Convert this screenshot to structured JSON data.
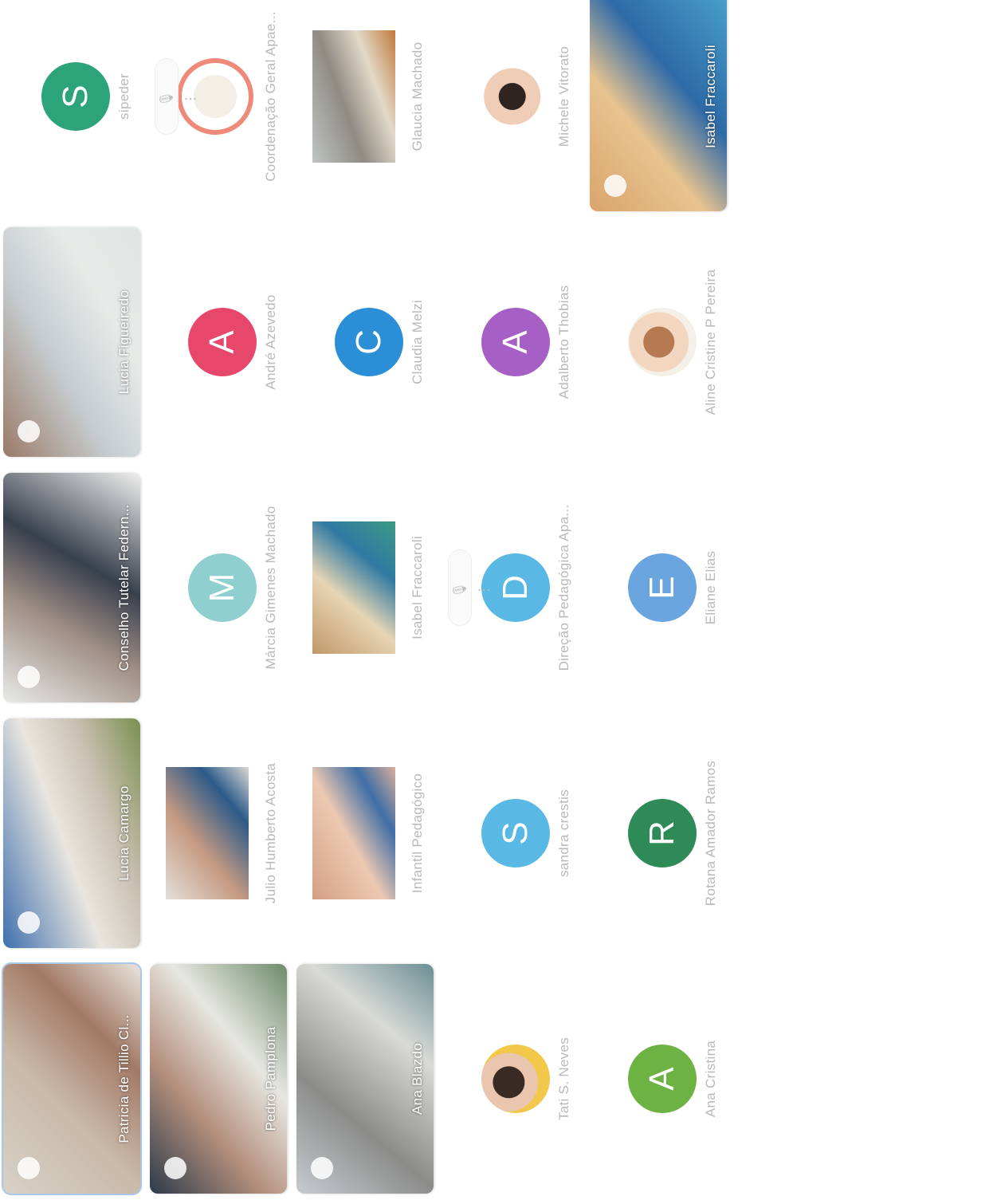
{
  "window": {
    "title": ""
  },
  "colors": {
    "green": "#2da37a",
    "pink": "#e8476c",
    "blue": "#2a8fd6",
    "purple": "#a65fc4",
    "teal": "#8fcfcf",
    "lightblue": "#5ab8e4",
    "bluegray": "#6aa5e0",
    "darkgreen": "#2e8b57",
    "lightgreen": "#6cb343",
    "ring_pink": "#ef8a7b"
  },
  "participants": [
    {
      "name": "Patricia de Tillio Cl...",
      "kind": "video",
      "active": true,
      "icon": "person-video"
    },
    {
      "name": "Lucia Camargo",
      "kind": "video",
      "icon": "person-video"
    },
    {
      "name": "Conselho Tutelar Federn...",
      "kind": "video",
      "icon": "person-video"
    },
    {
      "name": "Lucia Figueiredo",
      "kind": "video",
      "icon": "person-video"
    },
    {
      "name": "sipeder",
      "kind": "avatar",
      "letter": "S",
      "color": "green"
    },
    {
      "name": "Pedro Pamplona",
      "kind": "video",
      "icon": "person-video"
    },
    {
      "name": "Julio Humberto Acosta",
      "kind": "snapshot",
      "icon": "person-snapshot"
    },
    {
      "name": "Márcia Gimenes Machado",
      "kind": "avatar",
      "letter": "M",
      "color": "teal"
    },
    {
      "name": "André Azevedo",
      "kind": "avatar",
      "letter": "A",
      "color": "pink"
    },
    {
      "name": "Coordenação Geral Apae...",
      "kind": "photo-ring",
      "icon": "logo-ring",
      "hover_controls": "🎙 ⋮"
    },
    {
      "name": "Ana Blazdo",
      "kind": "video",
      "icon": "person-video"
    },
    {
      "name": "Infantil Pedagógico",
      "kind": "snapshot",
      "icon": "room-snapshot"
    },
    {
      "name": "Isabel Fraccaroli",
      "kind": "snapshot",
      "icon": "person-snapshot"
    },
    {
      "name": "Claudia Melzi",
      "kind": "avatar",
      "letter": "C",
      "color": "blue"
    },
    {
      "name": "Glaucia Machado",
      "kind": "snapshot",
      "icon": "room-snapshot"
    },
    {
      "name": "Tati S. Neves",
      "kind": "photo-avatar",
      "icon": "profile-photo"
    },
    {
      "name": "sandra crestis",
      "kind": "avatar",
      "letter": "S",
      "color": "lightblue"
    },
    {
      "name": "Direção Pedagógica Apa...",
      "kind": "avatar",
      "letter": "D",
      "color": "lightblue",
      "hover_controls": "🎙 ⋮"
    },
    {
      "name": "Adalberto Thobias",
      "kind": "avatar",
      "letter": "A",
      "color": "purple"
    },
    {
      "name": "Michele Vitorato",
      "kind": "photo-avatar",
      "icon": "profile-photo"
    },
    {
      "name": "Ana Cristina",
      "kind": "avatar",
      "letter": "A",
      "color": "lightgreen"
    },
    {
      "name": "Rotana Amador Ramos",
      "kind": "avatar",
      "letter": "R",
      "color": "darkgreen"
    },
    {
      "name": "Eliane Elias",
      "kind": "avatar",
      "letter": "E",
      "color": "bluegray"
    },
    {
      "name": "Aline Cristine P Pereira",
      "kind": "photo-avatar",
      "icon": "profile-photo"
    },
    {
      "name": "Isabel Fraccaroli",
      "kind": "video",
      "icon": "person-video"
    }
  ]
}
